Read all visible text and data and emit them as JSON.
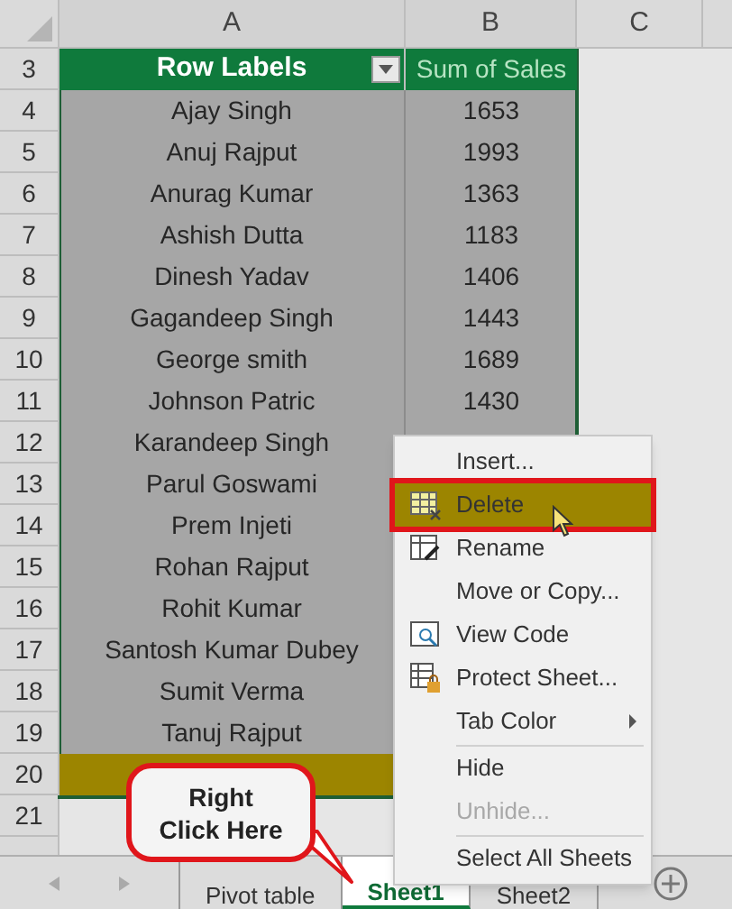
{
  "column_headers": [
    "A",
    "B",
    "C"
  ],
  "pivot": {
    "header": {
      "row_number": "3",
      "label": "Row Labels",
      "value": "Sum of Sales"
    },
    "rows": [
      {
        "row_number": "4",
        "label": "Ajay Singh",
        "value": "1653"
      },
      {
        "row_number": "5",
        "label": "Anuj Rajput",
        "value": "1993"
      },
      {
        "row_number": "6",
        "label": "Anurag Kumar",
        "value": "1363"
      },
      {
        "row_number": "7",
        "label": "Ashish Dutta",
        "value": "1183"
      },
      {
        "row_number": "8",
        "label": "Dinesh Yadav",
        "value": "1406"
      },
      {
        "row_number": "9",
        "label": "Gagandeep Singh",
        "value": "1443"
      },
      {
        "row_number": "10",
        "label": "George smith",
        "value": "1689"
      },
      {
        "row_number": "11",
        "label": "Johnson Patric",
        "value": "1430"
      },
      {
        "row_number": "12",
        "label": "Karandeep Singh"
      },
      {
        "row_number": "13",
        "label": "Parul Goswami"
      },
      {
        "row_number": "14",
        "label": "Prem Injeti"
      },
      {
        "row_number": "15",
        "label": "Rohan Rajput"
      },
      {
        "row_number": "16",
        "label": "Rohit Kumar"
      },
      {
        "row_number": "17",
        "label": "Santosh Kumar Dubey"
      },
      {
        "row_number": "18",
        "label": "Sumit Verma"
      },
      {
        "row_number": "19",
        "label": "Tanuj Rajput"
      }
    ],
    "total_row": {
      "row_number": "20"
    }
  },
  "empty_rows": [
    "21"
  ],
  "context_menu": {
    "items": [
      {
        "kind": "item",
        "label": "Insert...",
        "selected": false,
        "disabled": false,
        "submenu": false
      },
      {
        "kind": "item",
        "label": "Delete",
        "selected": true,
        "disabled": false,
        "submenu": false
      },
      {
        "kind": "item",
        "label": "Rename",
        "selected": false,
        "disabled": false,
        "submenu": false
      },
      {
        "kind": "item",
        "label": "Move or Copy...",
        "selected": false,
        "disabled": false,
        "submenu": false
      },
      {
        "kind": "item",
        "label": "View Code",
        "selected": false,
        "disabled": false,
        "submenu": false
      },
      {
        "kind": "item",
        "label": "Protect Sheet...",
        "selected": false,
        "disabled": false,
        "submenu": false
      },
      {
        "kind": "item",
        "label": "Tab Color",
        "selected": false,
        "disabled": false,
        "submenu": true
      },
      {
        "kind": "separator"
      },
      {
        "kind": "item",
        "label": "Hide",
        "selected": false,
        "disabled": false,
        "submenu": false
      },
      {
        "kind": "item",
        "label": "Unhide...",
        "selected": false,
        "disabled": true,
        "submenu": false
      },
      {
        "kind": "separator"
      },
      {
        "kind": "item",
        "label": "Select All Sheets",
        "selected": false,
        "disabled": false,
        "submenu": false
      }
    ]
  },
  "sheet_tabs": [
    {
      "label": "Pivot table",
      "selected": false
    },
    {
      "label": "Sheet1",
      "selected": true
    },
    {
      "label": "Sheet2",
      "selected": false
    }
  ],
  "callout": {
    "text": "Right\nClick Here"
  }
}
